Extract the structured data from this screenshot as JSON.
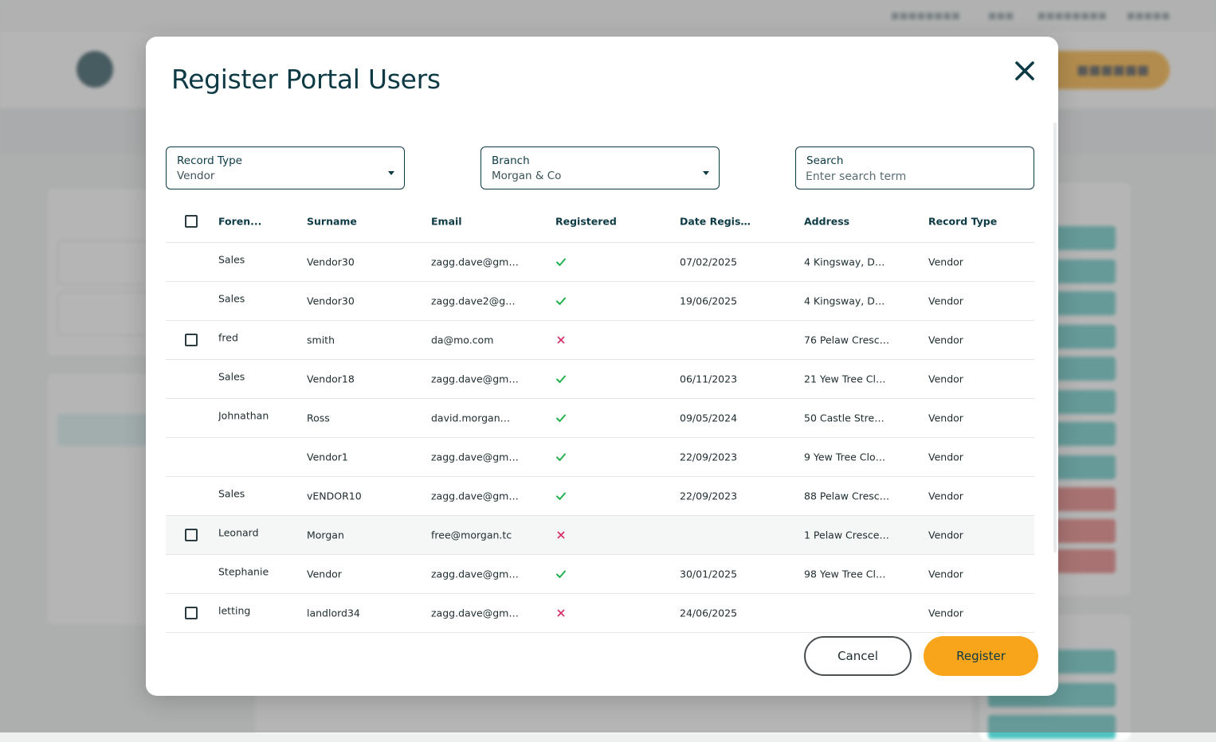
{
  "modal": {
    "title": "Register Portal Users",
    "filters": {
      "record_type": {
        "label": "Record Type",
        "value": "Vendor"
      },
      "branch": {
        "label": "Branch",
        "value": "Morgan & Co"
      },
      "search": {
        "label": "Search",
        "placeholder": "Enter search term"
      }
    },
    "table": {
      "headers": {
        "forename": "Foren...",
        "surname": "Surname",
        "email": "Email",
        "registered": "Registered",
        "date_registered": "Date Regist...",
        "address": "Address",
        "record_type": "Record Type"
      },
      "rows": [
        {
          "selectable": false,
          "forename": "Sales",
          "surname": "Vendor30",
          "email": "zagg.dave@gmai...",
          "registered": true,
          "date": "07/02/2025",
          "address": "4 Kingsway, Darli...",
          "record_type": "Vendor"
        },
        {
          "selectable": false,
          "forename": "Sales",
          "surname": "Vendor30",
          "email": "zagg.dave2@gm...",
          "registered": true,
          "date": "19/06/2025",
          "address": "4 Kingsway, Darli...",
          "record_type": "Vendor"
        },
        {
          "selectable": true,
          "forename": "fred",
          "surname": "smith",
          "email": "da@mo.com",
          "registered": false,
          "date": "",
          "address": "76 Pelaw Cresce...",
          "record_type": "Vendor"
        },
        {
          "selectable": false,
          "forename": "Sales",
          "surname": "Vendor18",
          "email": "zagg.dave@gmai...",
          "registered": true,
          "date": "06/11/2023",
          "address": "21 Yew Tree Clos...",
          "record_type": "Vendor"
        },
        {
          "selectable": false,
          "forename": "Johnathan",
          "surname": "Ross",
          "email": "david.morgan@ia...",
          "registered": true,
          "date": "09/05/2024",
          "address": "50 Castle Street,...",
          "record_type": "Vendor"
        },
        {
          "selectable": false,
          "forename": "",
          "surname": "Vendor1",
          "email": "zagg.dave@gmai...",
          "registered": true,
          "date": "22/09/2023",
          "address": "9 Yew Tree Close...",
          "record_type": "Vendor"
        },
        {
          "selectable": false,
          "forename": "Sales",
          "surname": "vENDOR10",
          "email": "zagg.dave@gmai...",
          "registered": true,
          "date": "22/09/2023",
          "address": "88 Pelaw Cresce...",
          "record_type": "Vendor"
        },
        {
          "selectable": true,
          "forename": "Leonard",
          "surname": "Morgan",
          "email": "free@morgan.tc",
          "registered": false,
          "date": "",
          "address": "1 Pelaw Crescent...",
          "record_type": "Vendor",
          "highlighted": true
        },
        {
          "selectable": false,
          "forename": "Stephanie",
          "surname": "Vendor",
          "email": "zagg.dave@gmai...",
          "registered": true,
          "date": "30/01/2025",
          "address": "98 Yew Tree Clos...",
          "record_type": "Vendor"
        },
        {
          "selectable": true,
          "forename": "letting",
          "surname": "landlord34",
          "email": "zagg.dave@gmai...",
          "registered": false,
          "date": "24/06/2025",
          "address": "",
          "record_type": "Vendor"
        }
      ]
    },
    "buttons": {
      "cancel": "Cancel",
      "register": "Register"
    }
  },
  "icons": {
    "close": "close-icon",
    "registered_yes": "check-icon",
    "registered_no": "cross-icon",
    "dropdown": "chevron-down-icon"
  },
  "colors": {
    "primary": "#0d3a44",
    "accent": "#f9a51b",
    "check": "#22b14c",
    "cross": "#d6336c"
  }
}
